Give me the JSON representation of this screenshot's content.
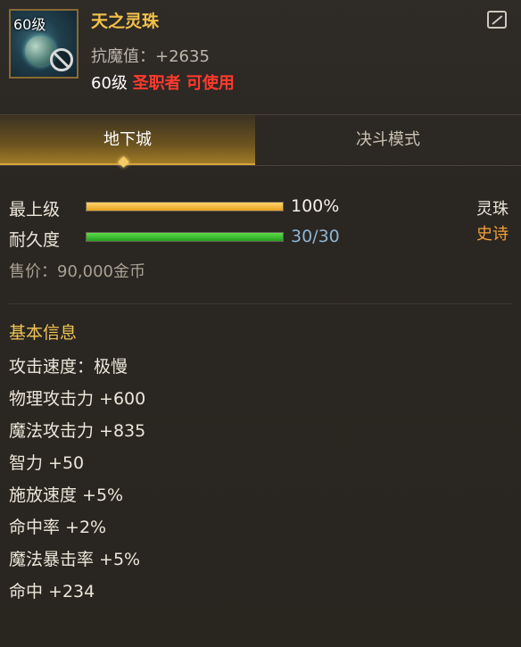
{
  "item": {
    "icon_level": "60级",
    "name": "天之灵珠",
    "top_stat": "抗魔值：+2635",
    "req_level": "60级",
    "req_restriction": "圣职者 可使用",
    "icons": {
      "share": "share-icon",
      "forbidden": "no-entry-icon"
    }
  },
  "tabs": [
    {
      "label": "地下城",
      "active": true
    },
    {
      "label": "决斗模式",
      "active": false
    }
  ],
  "grade": {
    "label": "最上级",
    "value": "100%",
    "fraction": 1.0
  },
  "durability": {
    "label": "耐久度",
    "value": "30/30",
    "fraction": 1.0
  },
  "item_type": "灵珠",
  "rarity": "史诗",
  "price": "售价：90,000金币",
  "basic_info": {
    "title": "基本信息",
    "attributes": [
      "攻击速度：极慢",
      "物理攻击力 +600",
      "魔法攻击力 +835",
      "智力 +50",
      "施放速度 +5%",
      "命中率 +2%",
      "魔法暴击率 +5%",
      "命中 +234"
    ]
  },
  "colors": {
    "item_name": "#f2c14a",
    "restriction": "#ff3a2e",
    "rarity": "#f2a13a",
    "grade_bar": "#e6a21e",
    "durability_bar": "#23a01e"
  }
}
